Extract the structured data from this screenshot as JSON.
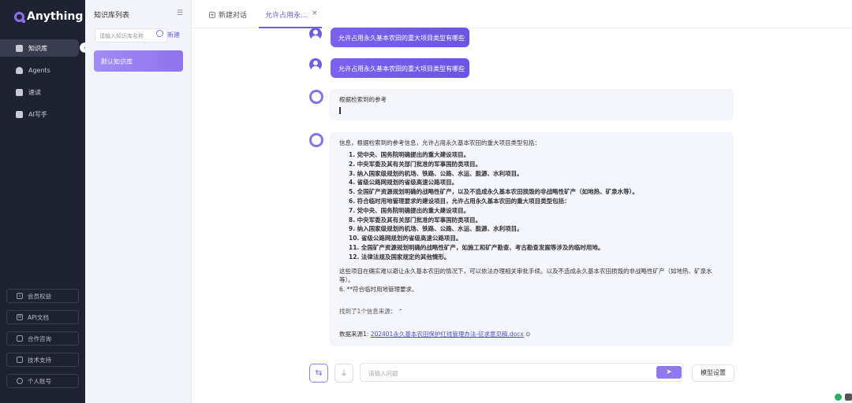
{
  "brand": {
    "name": "Anything"
  },
  "nav": {
    "items": [
      {
        "label": "知识库",
        "icon": "book-icon"
      },
      {
        "label": "Agents",
        "icon": "robot-icon"
      },
      {
        "label": "速读",
        "icon": "document-icon"
      },
      {
        "label": "AI写手",
        "icon": "pen-icon"
      }
    ],
    "footer": [
      {
        "label": "会员权益",
        "icon": "home-icon"
      },
      {
        "label": "API文档",
        "icon": "doc-icon"
      },
      {
        "label": "合作咨询",
        "icon": "chat-icon"
      },
      {
        "label": "技术支持",
        "icon": "support-icon"
      },
      {
        "label": "个人账号",
        "icon": "user-icon"
      }
    ]
  },
  "kb": {
    "title": "知识库列表",
    "search_placeholder": "请输入知识库名称",
    "new_label": "新建",
    "default_card": "默认知识库"
  },
  "tabs": {
    "new_chat": "新建对话",
    "current": "允许占用永...",
    "close": "×"
  },
  "messages": {
    "user_q1": "允许占用永久基本农田的重大项目类型有哪些",
    "user_q2": "允许占用永久基本农田的重大项目类型有哪些",
    "thinking": "根据检索到的参考",
    "answer_intro": "信息，根据检索到的参考信息，允许占用永久基本农田的重大项目类型包括：",
    "answer_list": [
      "1. 党中央、国务院明确提出的重大建设项目。",
      "2. 中央军委及其有关部门批准的军事国防类项目。",
      "3. 纳入国家级规划的机场、铁路、公路、水运、能源、水利项目。",
      "4. 省级公路网规划的省级高速公路项目。",
      "5. 全国矿产资源规划明确的战略性矿产，以及不造成永久基本农田损毁的非战略性矿产（如地热、矿泉水等）。",
      "6. 符合临时用地管理要求的建设项目，允许占用永久基本农田的重大项目类型包括：",
      "7. 党中央、国务院明确提出的重大建设项目。",
      "8. 中央军委及其有关部门批准的军事国防类项目。",
      "9. 纳入国家级规划的机场、铁路、公路、水运、能源、水利项目。",
      "10. 省级公路网规划的省级高速公路项目。",
      "11. 全国矿产资源规划明确的战略性矿产，如施工和矿产勘查、考古勘查发掘等涉及的临时用地。",
      "12. 法律法规及国家规定的其他情形。"
    ],
    "answer_p1": "这些项目在确实难以避让永久基本农田的情况下，可以依法办理相关审批手续。以及不造成永久基本农田损毁的非战略性矿产（如地热、矿泉水等）。",
    "answer_p2": "6. **符合临时用地管理要求。",
    "sources_found": "找到了1个信息来源：",
    "source_prefix": "数据来源1:",
    "source_link": "202401永久基本农田保护红线管理办法-征求意见稿.docx"
  },
  "composer": {
    "placeholder": "请输入问题",
    "model_settings": "模型设置"
  },
  "colors": {
    "accent": "#6d5ce6",
    "nav_bg": "#1f2231",
    "panel_bg": "#f3f4f9"
  }
}
